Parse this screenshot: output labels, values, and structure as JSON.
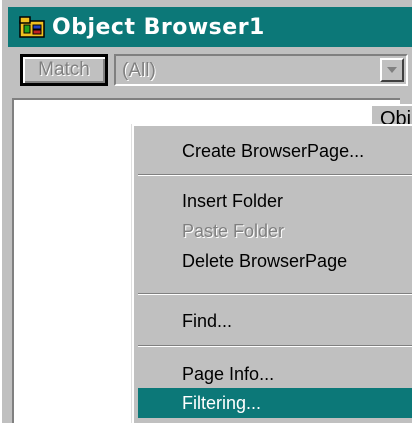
{
  "window": {
    "title": "Object Browser1",
    "title_bar_color": "#0c7878",
    "icon": "object-browser-icon"
  },
  "toolbar": {
    "match_label": "Match",
    "filter_value": "(All)",
    "dropdown_icon": "chevron-down-icon"
  },
  "tab": {
    "label": "Obj"
  },
  "context_menu": {
    "items": [
      {
        "label": "Create BrowserPage...",
        "enabled": true,
        "selected": false
      },
      {
        "label": "Insert Folder",
        "enabled": true,
        "selected": false
      },
      {
        "label": "Paste Folder",
        "enabled": false,
        "selected": false
      },
      {
        "label": "Delete BrowserPage",
        "enabled": true,
        "selected": false
      },
      {
        "label": "Find...",
        "enabled": true,
        "selected": false
      },
      {
        "label": "Page Info...",
        "enabled": true,
        "selected": false
      },
      {
        "label": "Filtering...",
        "enabled": true,
        "selected": true
      }
    ],
    "highlight_color": "#0c7878"
  }
}
